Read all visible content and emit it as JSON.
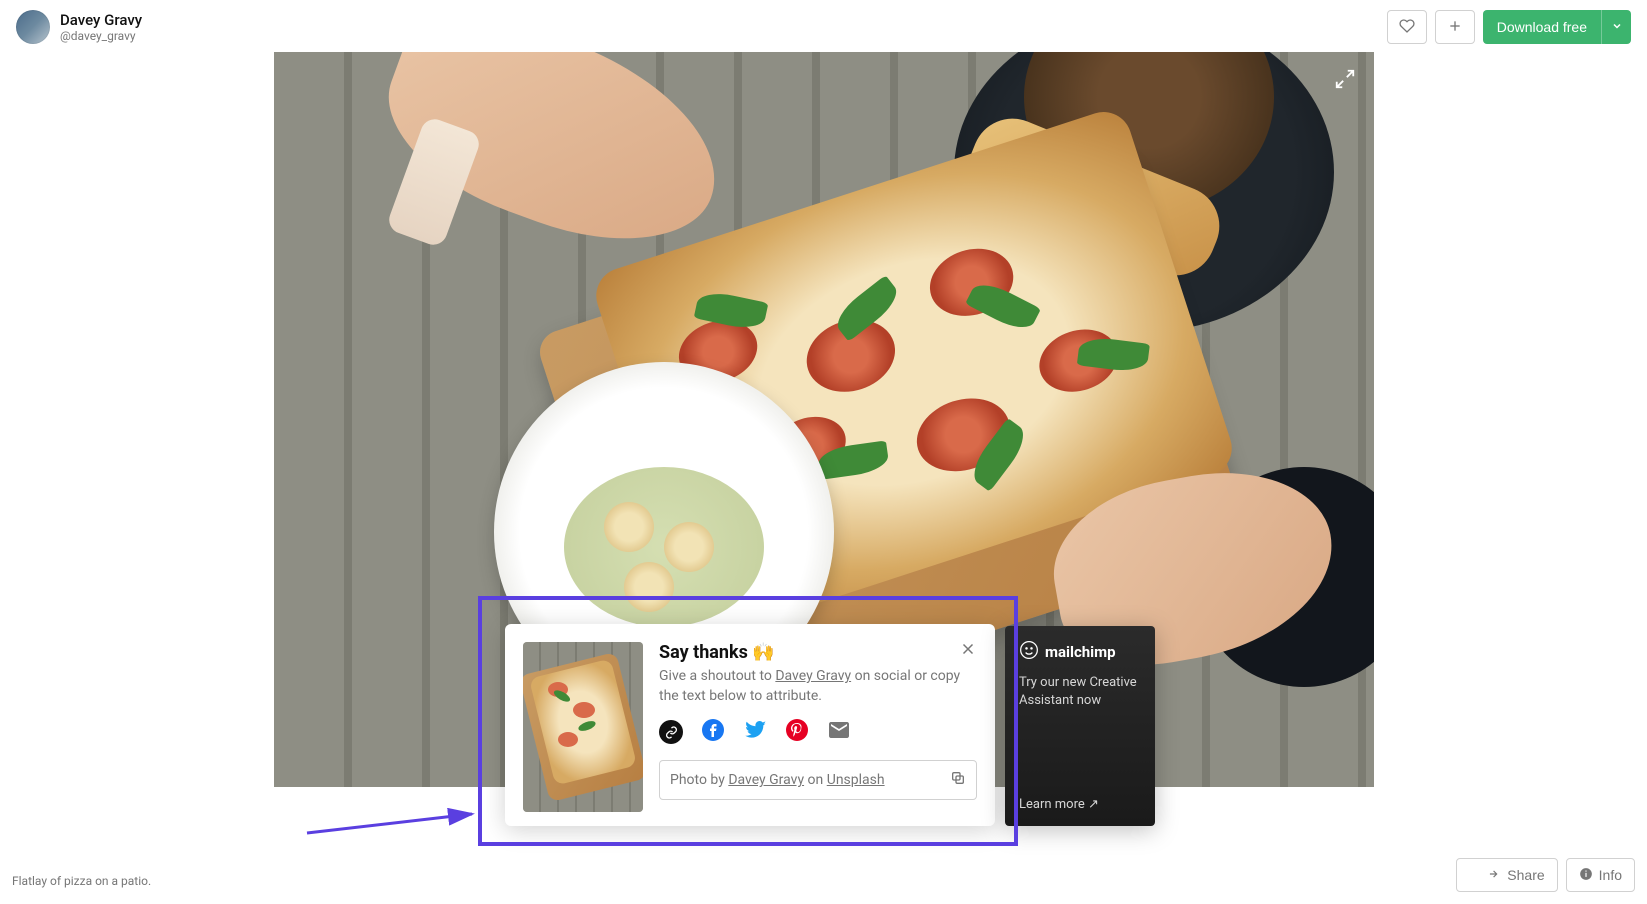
{
  "user": {
    "name": "Davey Gravy",
    "handle": "@davey_gravy"
  },
  "header": {
    "download_label": "Download free"
  },
  "caption": "Flatlay of pizza on a patio.",
  "thanks": {
    "title": "Say thanks",
    "emoji": "🙌",
    "sub_prefix": "Give a shoutout to ",
    "author": "Davey Gravy",
    "sub_suffix": " on social or copy the text below to attribute.",
    "attrib_prefix": "Photo by ",
    "attrib_author": "Davey Gravy",
    "attrib_mid": " on ",
    "attrib_site": "Unsplash"
  },
  "ad": {
    "brand": "mailchimp",
    "text": "Try our new Creative Assistant now",
    "learn": "Learn more ↗"
  },
  "footer": {
    "share": "Share",
    "info": "Info"
  }
}
